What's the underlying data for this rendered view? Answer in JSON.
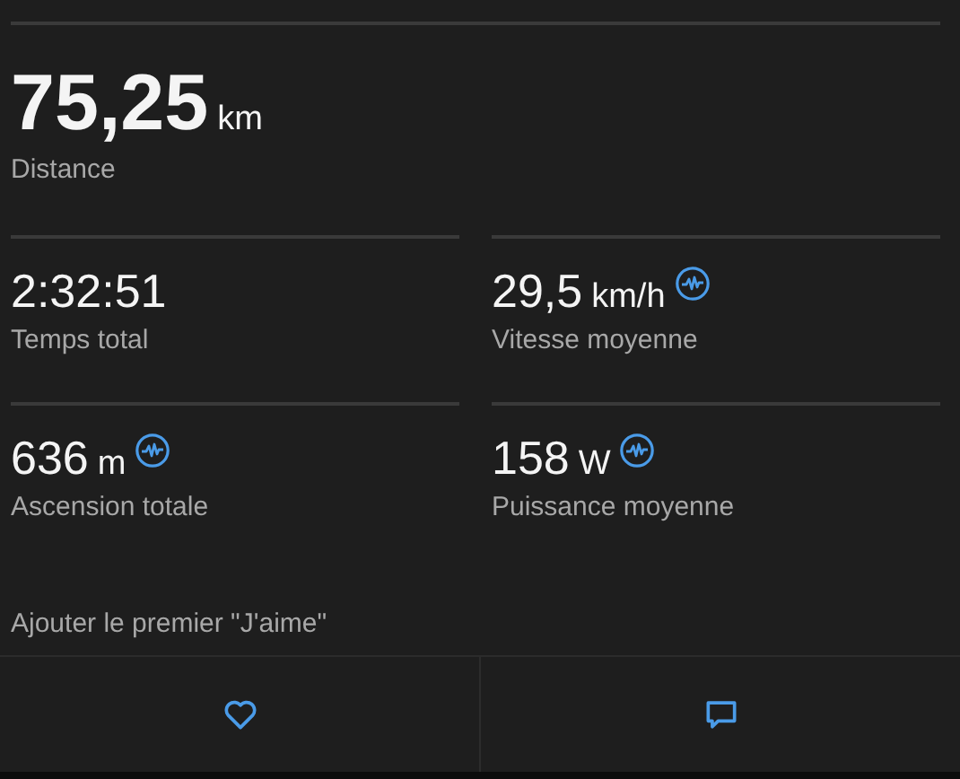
{
  "main_stat": {
    "value": "75,25",
    "unit": "km",
    "label": "Distance"
  },
  "stats": [
    {
      "value": "2:32:51",
      "label": "Temps total",
      "chart_icon": false
    },
    {
      "value": "29,5",
      "unit": "km/h",
      "label": "Vitesse moyenne",
      "chart_icon": true
    },
    {
      "value": "636",
      "unit": "m",
      "label": "Ascension totale",
      "chart_icon": true
    },
    {
      "value": "158",
      "unit": "W",
      "label": "Puissance moyenne",
      "chart_icon": true
    }
  ],
  "like_prompt": "Ajouter le premier \"J'aime\""
}
